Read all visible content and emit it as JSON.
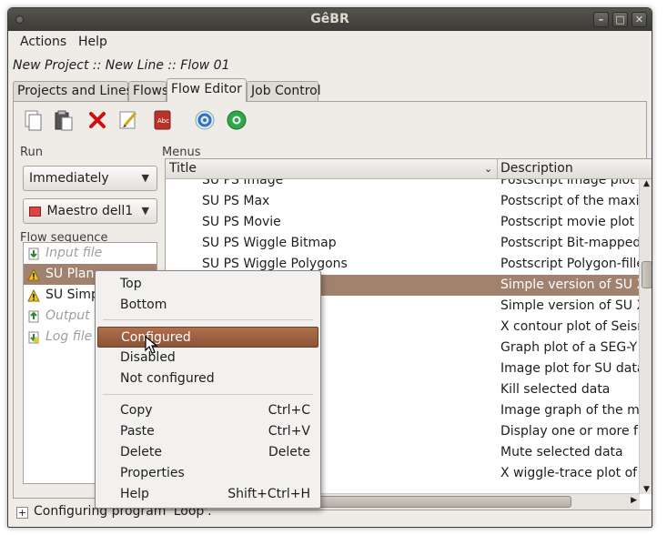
{
  "window": {
    "title": "GêBR",
    "minimize": "–",
    "maximize": "□",
    "close": "✕"
  },
  "menubar": {
    "actions": "Actions",
    "help": "Help"
  },
  "breadcrumb": "New Project :: New Line :: Flow 01",
  "tabs": [
    {
      "label": "Projects and Lines"
    },
    {
      "label": "Flows"
    },
    {
      "label": "Flow Editor"
    },
    {
      "label": "Job Control"
    }
  ],
  "toolbar": {
    "icons": [
      "new-document-icon",
      "paste-icon",
      "delete-icon",
      "edit-icon",
      "dictionary-icon",
      "execute-icon",
      "help-icon"
    ]
  },
  "run": {
    "label": "Run",
    "mode_value": "Immediately",
    "server_value": "Maestro dell1"
  },
  "flow_sequence": {
    "label": "Flow sequence",
    "items": [
      {
        "label": "Input file",
        "state": "disabled",
        "icon": "input-file-icon"
      },
      {
        "label": "SU Plane",
        "state": "selected-warning",
        "icon": "warning-icon"
      },
      {
        "label": "SU Simple",
        "state": "warning",
        "icon": "warning-icon"
      },
      {
        "label": "Output file",
        "state": "disabled",
        "icon": "output-file-icon"
      },
      {
        "label": "Log file",
        "state": "disabled",
        "icon": "log-file-icon"
      }
    ]
  },
  "menus": {
    "label": "Menus",
    "col_title": "Title",
    "col_description": "Description",
    "rows": [
      {
        "title": "SU PS Image",
        "desc": "Postscript image plot o"
      },
      {
        "title": "SU PS Max",
        "desc": "Postscript of the maxim"
      },
      {
        "title": "SU PS Movie",
        "desc": "Postscript movie plot o"
      },
      {
        "title": "SU PS Wiggle Bitmap",
        "desc": "Postscript Bit-mapped"
      },
      {
        "title": "SU PS Wiggle Polygons",
        "desc": "Postscript Polygon-fille"
      },
      {
        "title": "",
        "desc": "Simple version of SU X"
      },
      {
        "title": "",
        "desc": "Simple version of SU X"
      },
      {
        "title": "",
        "desc": "X contour plot of Seism"
      },
      {
        "title": "",
        "desc": "Graph plot of a SEG-Y d"
      },
      {
        "title": "",
        "desc": "Image plot for SU data"
      },
      {
        "title": "",
        "desc": "Kill selected data"
      },
      {
        "title": "",
        "desc": "Image graph of the ma"
      },
      {
        "title": "",
        "desc": "Display one or more fra"
      },
      {
        "title": "",
        "desc": "Mute selected data"
      },
      {
        "title": "",
        "desc": "X wiggle-trace plot of S"
      }
    ]
  },
  "status": {
    "expander": "+",
    "text": "Configuring program 'Loop'."
  },
  "context_menu": {
    "top": "Top",
    "bottom": "Bottom",
    "configured": "Configured",
    "disabled": "Disabled",
    "not_configured": "Not configured",
    "copy": "Copy",
    "copy_accel": "Ctrl+C",
    "paste": "Paste",
    "paste_accel": "Ctrl+V",
    "delete": "Delete",
    "delete_accel": "Delete",
    "properties": "Properties",
    "help": "Help",
    "help_accel": "Shift+Ctrl+H"
  },
  "colors": {
    "selection": "#a1826f",
    "menu_highlight": "#9c5e3e",
    "titlebar": "#3c3b37"
  }
}
